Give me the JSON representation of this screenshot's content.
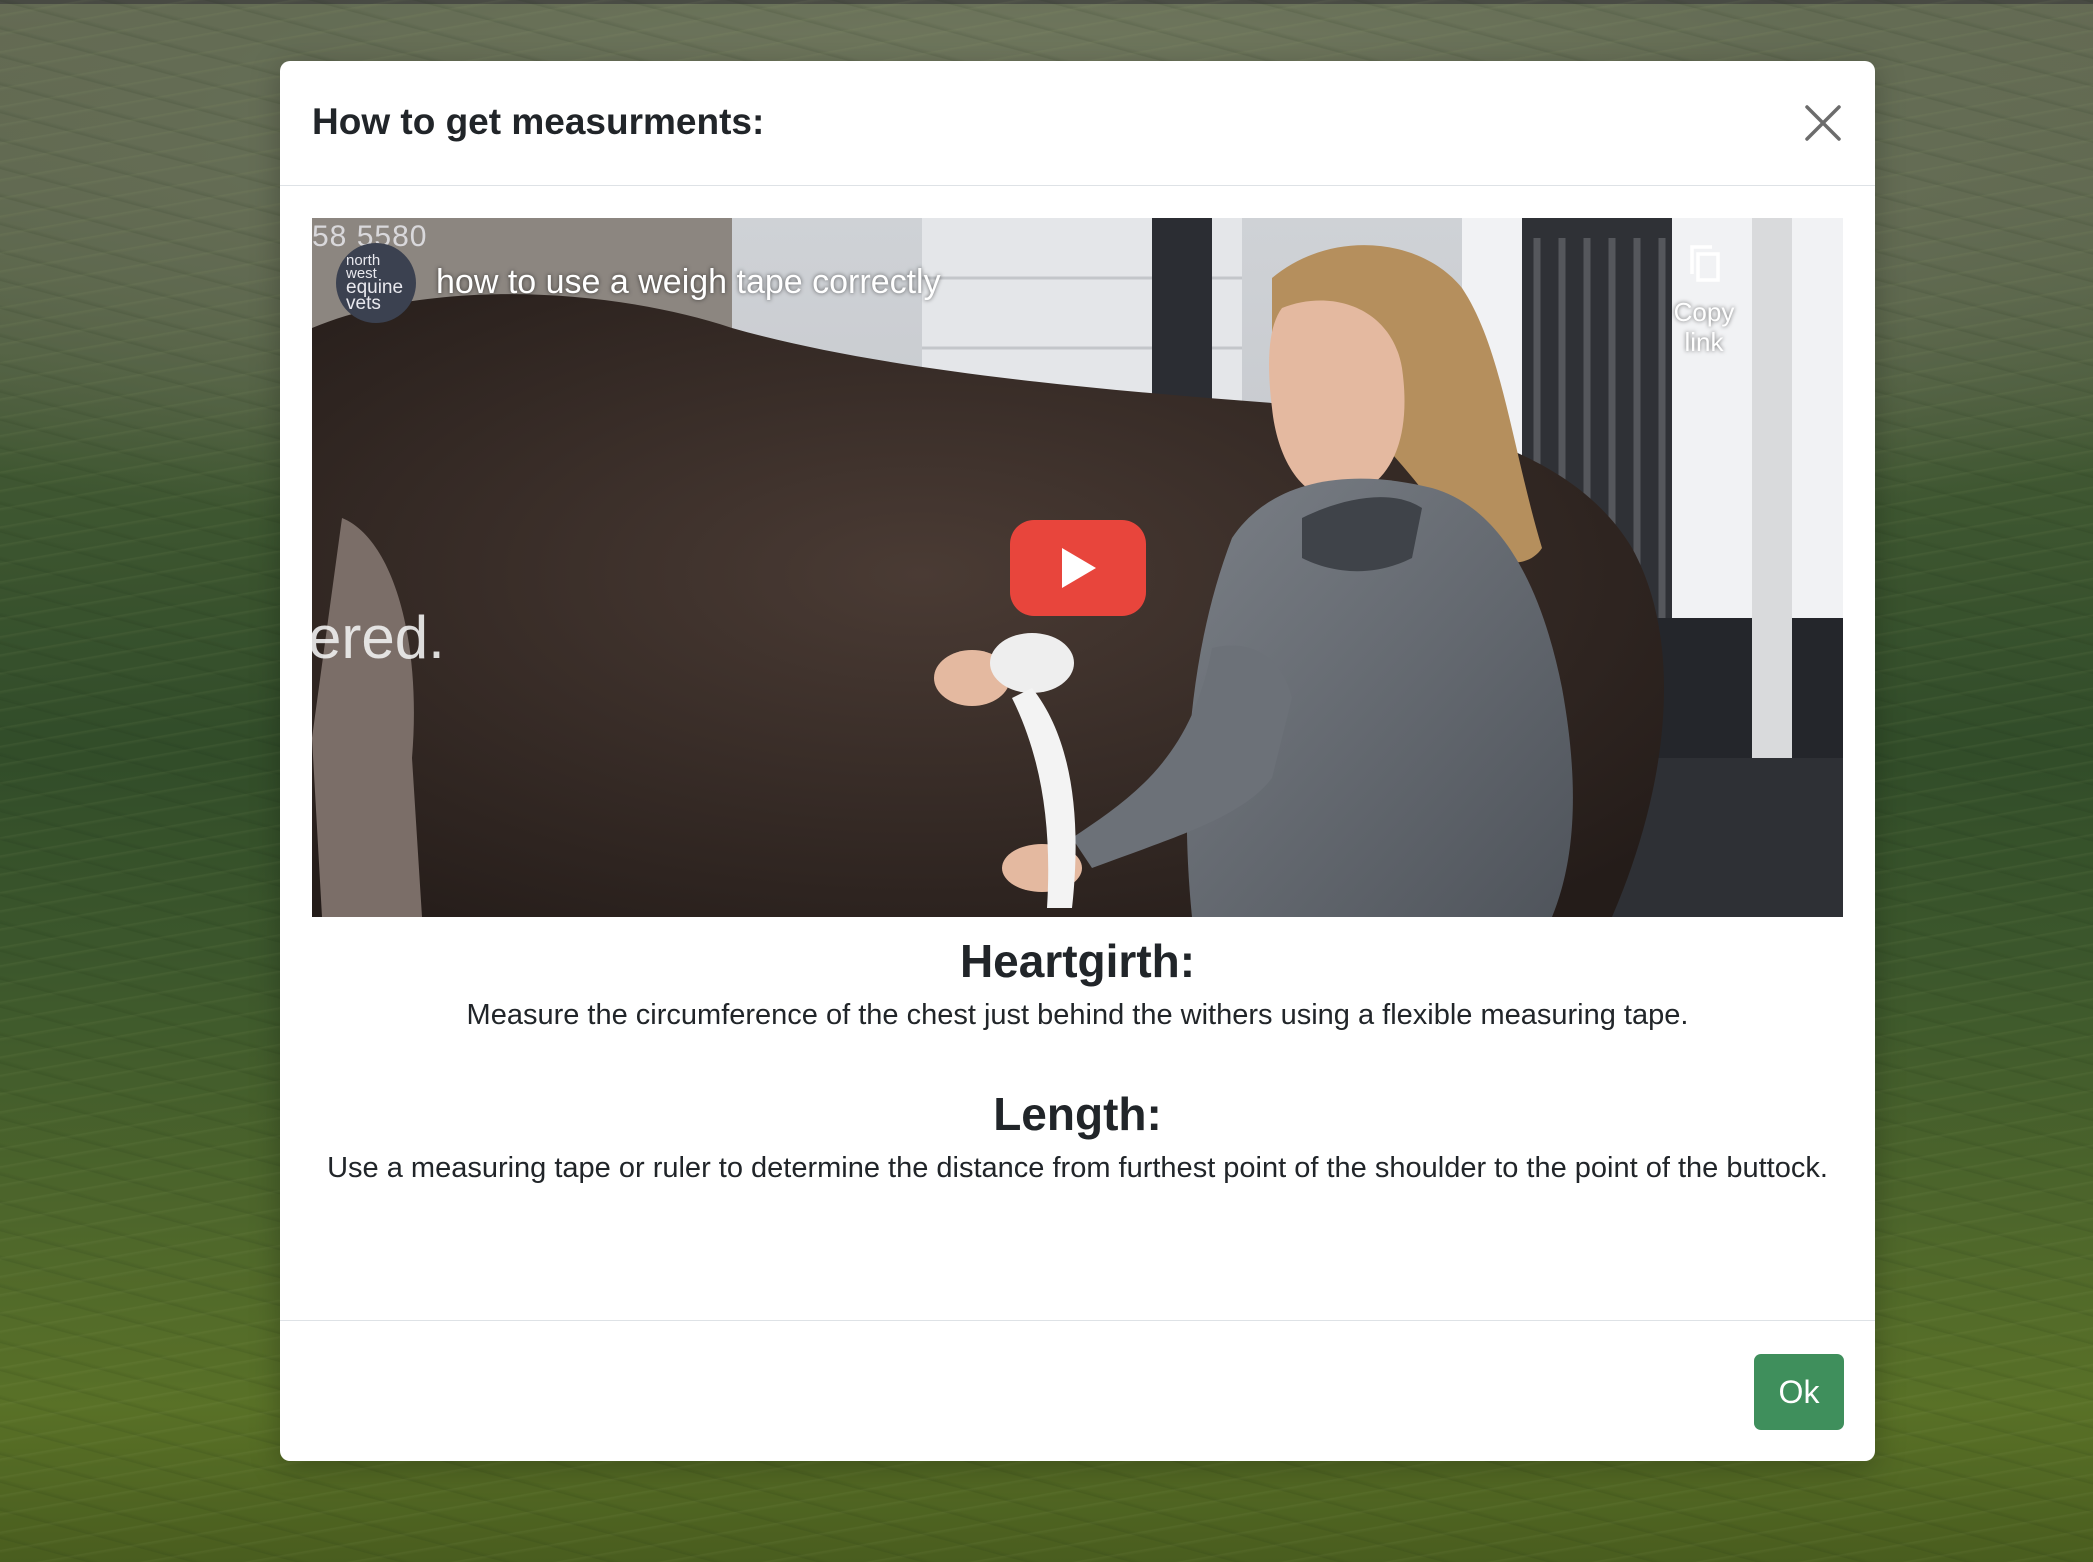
{
  "modal": {
    "title": "How to get measurments:",
    "close_icon": "close-icon",
    "ok_label": "Ok"
  },
  "video": {
    "channel_logo_lines": [
      "north",
      "west",
      "equine",
      "vets"
    ],
    "title": "how to use a weigh tape correctly",
    "phone_fragment": "58 5580",
    "side_text_fragment": "ered.",
    "copy_link_label": "Copy link",
    "copy_icon": "copy-icon",
    "play_icon": "play-icon",
    "play_color": "#e8453c"
  },
  "sections": [
    {
      "heading": "Heartgirth:",
      "text": "Measure the circumference of the chest just behind the withers using a flexible measuring tape."
    },
    {
      "heading": "Length:",
      "text": "Use a measuring tape or ruler to determine the distance from furthest point of the shoulder to the point of the buttock."
    }
  ],
  "colors": {
    "ok_button": "#3f8f5c",
    "text": "#212529"
  }
}
